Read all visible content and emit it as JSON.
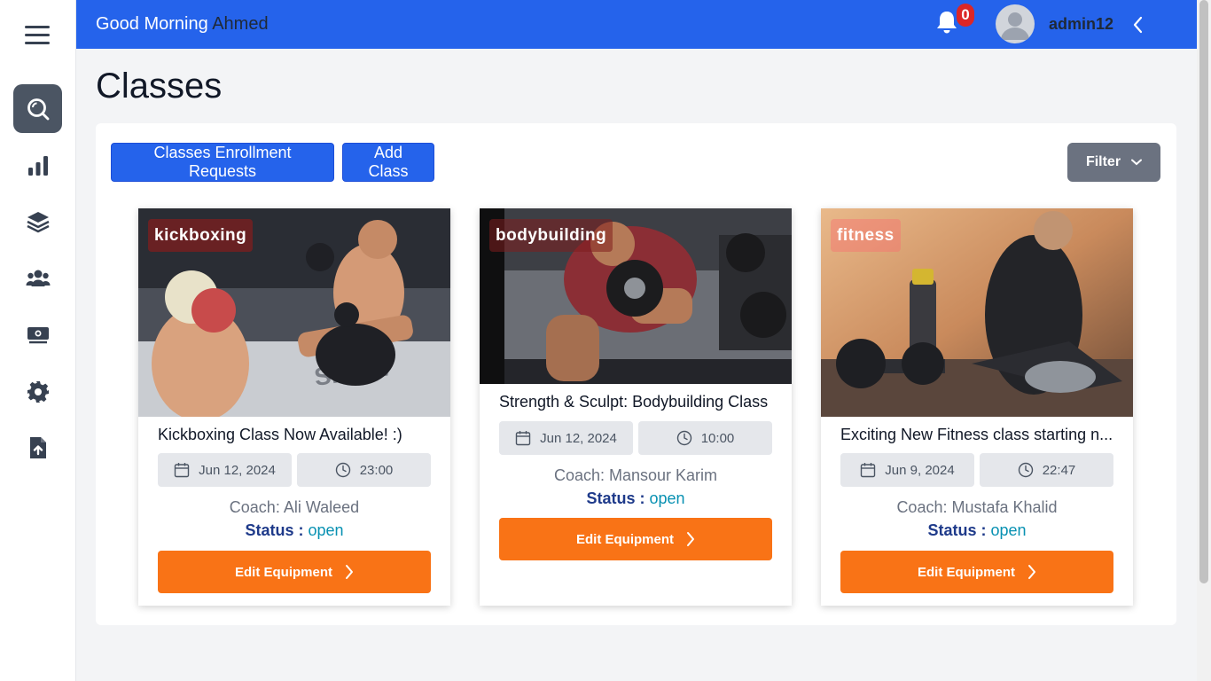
{
  "header": {
    "greeting": "Good Morning",
    "username": "Ahmed",
    "notification_count": "0",
    "admin_name": "admin12"
  },
  "sidebar": {
    "items": [
      {
        "icon": "search-icon",
        "active": true
      },
      {
        "icon": "bar-chart-icon",
        "active": false
      },
      {
        "icon": "layers-icon",
        "active": false
      },
      {
        "icon": "users-icon",
        "active": false
      },
      {
        "icon": "money-icon",
        "active": false
      },
      {
        "icon": "gear-icon",
        "active": false
      },
      {
        "icon": "file-upload-icon",
        "active": false
      }
    ]
  },
  "page": {
    "title": "Classes"
  },
  "toolbar": {
    "requests_label": "Classes Enrollment Requests",
    "add_label": "Add Class",
    "filter_label": "Filter"
  },
  "colors": {
    "primary": "#2563eb",
    "accent": "#f97316",
    "status_open": "#0891b2"
  },
  "cards": [
    {
      "tag": "kickboxing",
      "title": "Kickboxing Class Now Available! :)",
      "date": "Jun 12, 2024",
      "time": "23:00",
      "coach": "Coach: Ali Waleed",
      "status_label": "Status",
      "status_sep": ":",
      "status": "open",
      "button": "Edit Equipment"
    },
    {
      "tag": "bodybuilding",
      "title": "Strength & Sculpt: Bodybuilding Class",
      "date": "Jun 12, 2024",
      "time": "10:00",
      "coach": "Coach: Mansour Karim",
      "status_label": "Status",
      "status_sep": ":",
      "status": "open",
      "button": "Edit Equipment"
    },
    {
      "tag": "fitness",
      "title": "Exciting New Fitness class starting n...",
      "date": "Jun 9, 2024",
      "time": "22:47",
      "coach": "Coach: Mustafa Khalid",
      "status_label": "Status",
      "status_sep": ":",
      "status": "open",
      "button": "Edit Equipment"
    }
  ]
}
